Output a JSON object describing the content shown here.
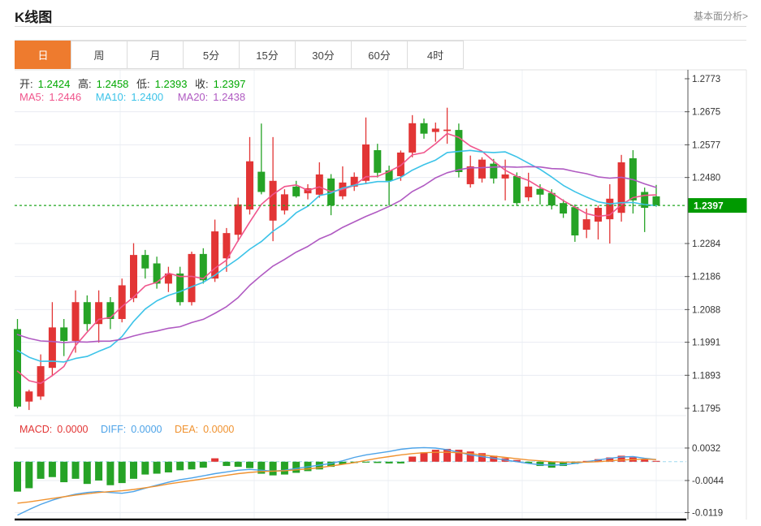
{
  "page": {
    "title": "K线图",
    "fundamental_link": "基本面分析>"
  },
  "tabs": [
    {
      "label": "日",
      "active": true
    },
    {
      "label": "周",
      "active": false
    },
    {
      "label": "月",
      "active": false
    },
    {
      "label": "5分",
      "active": false
    },
    {
      "label": "15分",
      "active": false
    },
    {
      "label": "30分",
      "active": false
    },
    {
      "label": "60分",
      "active": false
    },
    {
      "label": "4时",
      "active": false
    }
  ],
  "ohlc_legend": {
    "open_label": "开:",
    "open": "1.2424",
    "high_label": "高:",
    "high": "1.2458",
    "low_label": "低:",
    "low": "1.2393",
    "close_label": "收:",
    "close": "1.2397"
  },
  "ma_legend": {
    "ma5_label": "MA5:",
    "ma5": "1.2446",
    "ma10_label": "MA10:",
    "ma10": "1.2400",
    "ma20_label": "MA20:",
    "ma20": "1.2438"
  },
  "macd_legend": {
    "macd_label": "MACD:",
    "macd": "0.0000",
    "diff_label": "DIFF:",
    "diff": "0.0000",
    "dea_label": "DEA:",
    "dea": "0.0000"
  },
  "colors": {
    "accent_orange": "#ee7b2e",
    "up_red": "#e23535",
    "down_green": "#26a326",
    "ma5_pink": "#f0558c",
    "ma10_cyan": "#3cc3e8",
    "ma20_purple": "#b05ac2",
    "diff_blue": "#4da3e8",
    "dea_orange": "#f0922f",
    "badge_green": "#009a00",
    "grid": "#e9ecf2",
    "axis": "#555555"
  },
  "chart_data": {
    "type": "candlestick",
    "panes": [
      "price",
      "macd"
    ],
    "legend_position": "top-left",
    "grid": true,
    "price_axis": {
      "top_value": 1.2773,
      "bottom_value": 1.1795,
      "ticks": [
        "1.2773",
        "1.2675",
        "1.2577",
        "1.2480",
        "1.2284",
        "1.2186",
        "1.2088",
        "1.1991",
        "1.1893",
        "1.1795"
      ],
      "tick_values": [
        1.2773,
        1.2675,
        1.2577,
        1.248,
        1.2284,
        1.2186,
        1.2088,
        1.1991,
        1.1893,
        1.1795
      ],
      "current_price": "1.2397",
      "current_price_value": 1.2397
    },
    "candles_ohlc": [
      [
        1.203,
        1.206,
        1.1795,
        1.18
      ],
      [
        1.1815,
        1.185,
        1.179,
        1.1845
      ],
      [
        1.183,
        1.1955,
        1.182,
        1.192
      ],
      [
        1.1915,
        1.211,
        1.189,
        1.2035
      ],
      [
        1.2035,
        1.206,
        1.195,
        1.1995
      ],
      [
        1.1995,
        1.2145,
        1.196,
        1.211
      ],
      [
        1.211,
        1.213,
        1.2025,
        1.2045
      ],
      [
        1.2045,
        1.2145,
        1.199,
        1.211
      ],
      [
        1.211,
        1.2125,
        1.203,
        1.206
      ],
      [
        1.206,
        1.218,
        1.205,
        1.216
      ],
      [
        1.2122,
        1.2285,
        1.211,
        1.225
      ],
      [
        1.225,
        1.2265,
        1.218,
        1.221
      ],
      [
        1.2225,
        1.2245,
        1.215,
        1.2165
      ],
      [
        1.2165,
        1.2215,
        1.214,
        1.2195
      ],
      [
        1.2195,
        1.2215,
        1.21,
        1.211
      ],
      [
        1.211,
        1.226,
        1.21,
        1.2253
      ],
      [
        1.2253,
        1.227,
        1.2165,
        1.2175
      ],
      [
        1.218,
        1.2355,
        1.217,
        1.232
      ],
      [
        1.224,
        1.233,
        1.22,
        1.2315
      ],
      [
        1.231,
        1.242,
        1.229,
        1.24
      ],
      [
        1.2385,
        1.26,
        1.237,
        1.2528
      ],
      [
        1.2497,
        1.264,
        1.243,
        1.2437
      ],
      [
        1.2352,
        1.26,
        1.2291,
        1.247
      ],
      [
        1.2382,
        1.2445,
        1.237,
        1.243
      ],
      [
        1.2453,
        1.247,
        1.242,
        1.2424
      ],
      [
        1.2433,
        1.246,
        1.2415,
        1.2448
      ],
      [
        1.2429,
        1.2525,
        1.242,
        1.2489
      ],
      [
        1.2477,
        1.249,
        1.2368,
        1.2397
      ],
      [
        1.2424,
        1.2513,
        1.2415,
        1.2465
      ],
      [
        1.2453,
        1.2495,
        1.244,
        1.2482
      ],
      [
        1.247,
        1.2658,
        1.246,
        1.2578
      ],
      [
        1.2561,
        1.258,
        1.248,
        1.2494
      ],
      [
        1.2501,
        1.2515,
        1.2397,
        1.247
      ],
      [
        1.2484,
        1.256,
        1.247,
        1.2554
      ],
      [
        1.2554,
        1.2665,
        1.254,
        1.2641
      ],
      [
        1.2641,
        1.2655,
        1.2595,
        1.261
      ],
      [
        1.2615,
        1.2643,
        1.2586,
        1.2625
      ],
      [
        1.2618,
        1.2687,
        1.258,
        1.2622
      ],
      [
        1.2621,
        1.264,
        1.248,
        1.2496
      ],
      [
        1.246,
        1.2545,
        1.245,
        1.2513
      ],
      [
        1.2477,
        1.254,
        1.2465,
        1.2533
      ],
      [
        1.2521,
        1.2535,
        1.2462,
        1.2477
      ],
      [
        1.2477,
        1.2533,
        1.2412,
        1.2489
      ],
      [
        1.2484,
        1.2495,
        1.2395,
        1.2404
      ],
      [
        1.2421,
        1.2494,
        1.241,
        1.2453
      ],
      [
        1.2446,
        1.246,
        1.24,
        1.2429
      ],
      [
        1.2434,
        1.2445,
        1.2385,
        1.2397
      ],
      [
        1.2404,
        1.2415,
        1.236,
        1.2373
      ],
      [
        1.2392,
        1.24,
        1.2289,
        1.2308
      ],
      [
        1.2325,
        1.2388,
        1.23,
        1.2356
      ],
      [
        1.2349,
        1.2397,
        1.2296,
        1.239
      ],
      [
        1.2356,
        1.246,
        1.2284,
        1.2417
      ],
      [
        1.2375,
        1.2547,
        1.2349,
        1.2525
      ],
      [
        1.2537,
        1.2561,
        1.2373,
        1.2412
      ],
      [
        1.2437,
        1.245,
        1.2318,
        1.239
      ],
      [
        1.2424,
        1.2458,
        1.2393,
        1.2397
      ]
    ],
    "ma_periods": {
      "ma5": 5,
      "ma10": 10,
      "ma20": 20
    },
    "ma_seed_closes": [
      1.208,
      1.2075,
      1.207,
      1.2068,
      1.2065,
      1.2062,
      1.206,
      1.2058,
      1.2055,
      1.2052,
      1.205,
      1.2045,
      1.204,
      1.203,
      1.202,
      1.2005,
      1.1985,
      1.196,
      1.192,
      1.186
    ],
    "macd_axis": {
      "ticks": [
        "0.0032",
        "-0.0044",
        "-0.0119"
      ],
      "tick_values": [
        0.0032,
        -0.0044,
        -0.0119
      ],
      "zero_value": 0
    },
    "macd": {
      "hist": [
        -0.007,
        -0.0062,
        -0.004,
        -0.0036,
        -0.0048,
        -0.004,
        -0.0052,
        -0.0044,
        -0.0055,
        -0.005,
        -0.004,
        -0.003,
        -0.0028,
        -0.0025,
        -0.002,
        -0.0018,
        -0.0014,
        0.0008,
        -0.001,
        -0.0012,
        -0.0015,
        -0.0028,
        -0.0032,
        -0.003,
        -0.0026,
        -0.0022,
        -0.0018,
        -0.0012,
        -0.0006,
        -0.0003,
        -0.0002,
        -0.0003,
        -0.0004,
        -0.0004,
        0.0012,
        0.0022,
        0.0028,
        0.003,
        0.0028,
        0.0024,
        0.002,
        0.0014,
        0.0008,
        0.0004,
        -0.0004,
        -0.001,
        -0.0014,
        -0.001,
        -0.0005,
        0.0,
        0.0006,
        0.001,
        0.0014,
        0.001,
        0.0006,
        0.0002
      ],
      "diff": [
        -0.0125,
        -0.0112,
        -0.01,
        -0.009,
        -0.0082,
        -0.0076,
        -0.0072,
        -0.007,
        -0.0072,
        -0.0074,
        -0.007,
        -0.0062,
        -0.0055,
        -0.0048,
        -0.0042,
        -0.0038,
        -0.0033,
        -0.0028,
        -0.0024,
        -0.002,
        -0.0018,
        -0.002,
        -0.0022,
        -0.002,
        -0.0016,
        -0.0012,
        -0.0008,
        -0.0004,
        0.0002,
        0.001,
        0.0016,
        0.002,
        0.0024,
        0.0029,
        0.0032,
        0.0033,
        0.0032,
        0.0028,
        0.0022,
        0.0016,
        0.0012,
        0.0008,
        0.0004,
        0.0,
        -0.0004,
        -0.0007,
        -0.0008,
        -0.0007,
        -0.0004,
        0.0,
        0.0004,
        0.0008,
        0.0011,
        0.0012,
        0.0008,
        0.0005
      ],
      "dea": [
        -0.0097,
        -0.0094,
        -0.009,
        -0.0086,
        -0.0082,
        -0.0078,
        -0.0075,
        -0.0072,
        -0.007,
        -0.0068,
        -0.0065,
        -0.0061,
        -0.0057,
        -0.0052,
        -0.0048,
        -0.0044,
        -0.004,
        -0.0036,
        -0.0032,
        -0.0028,
        -0.0025,
        -0.0023,
        -0.0022,
        -0.0021,
        -0.0019,
        -0.0017,
        -0.0014,
        -0.001,
        -0.0006,
        -0.0002,
        0.0003,
        0.0008,
        0.0012,
        0.0016,
        0.0019,
        0.0021,
        0.0022,
        0.0022,
        0.0021,
        0.0019,
        0.0016,
        0.0013,
        0.001,
        0.0007,
        0.0004,
        0.0002,
        0.0,
        -0.0001,
        -0.0001,
        -0.0001,
        0.0,
        0.0002,
        0.0004,
        0.0005,
        0.0006,
        0.0005
      ]
    }
  }
}
